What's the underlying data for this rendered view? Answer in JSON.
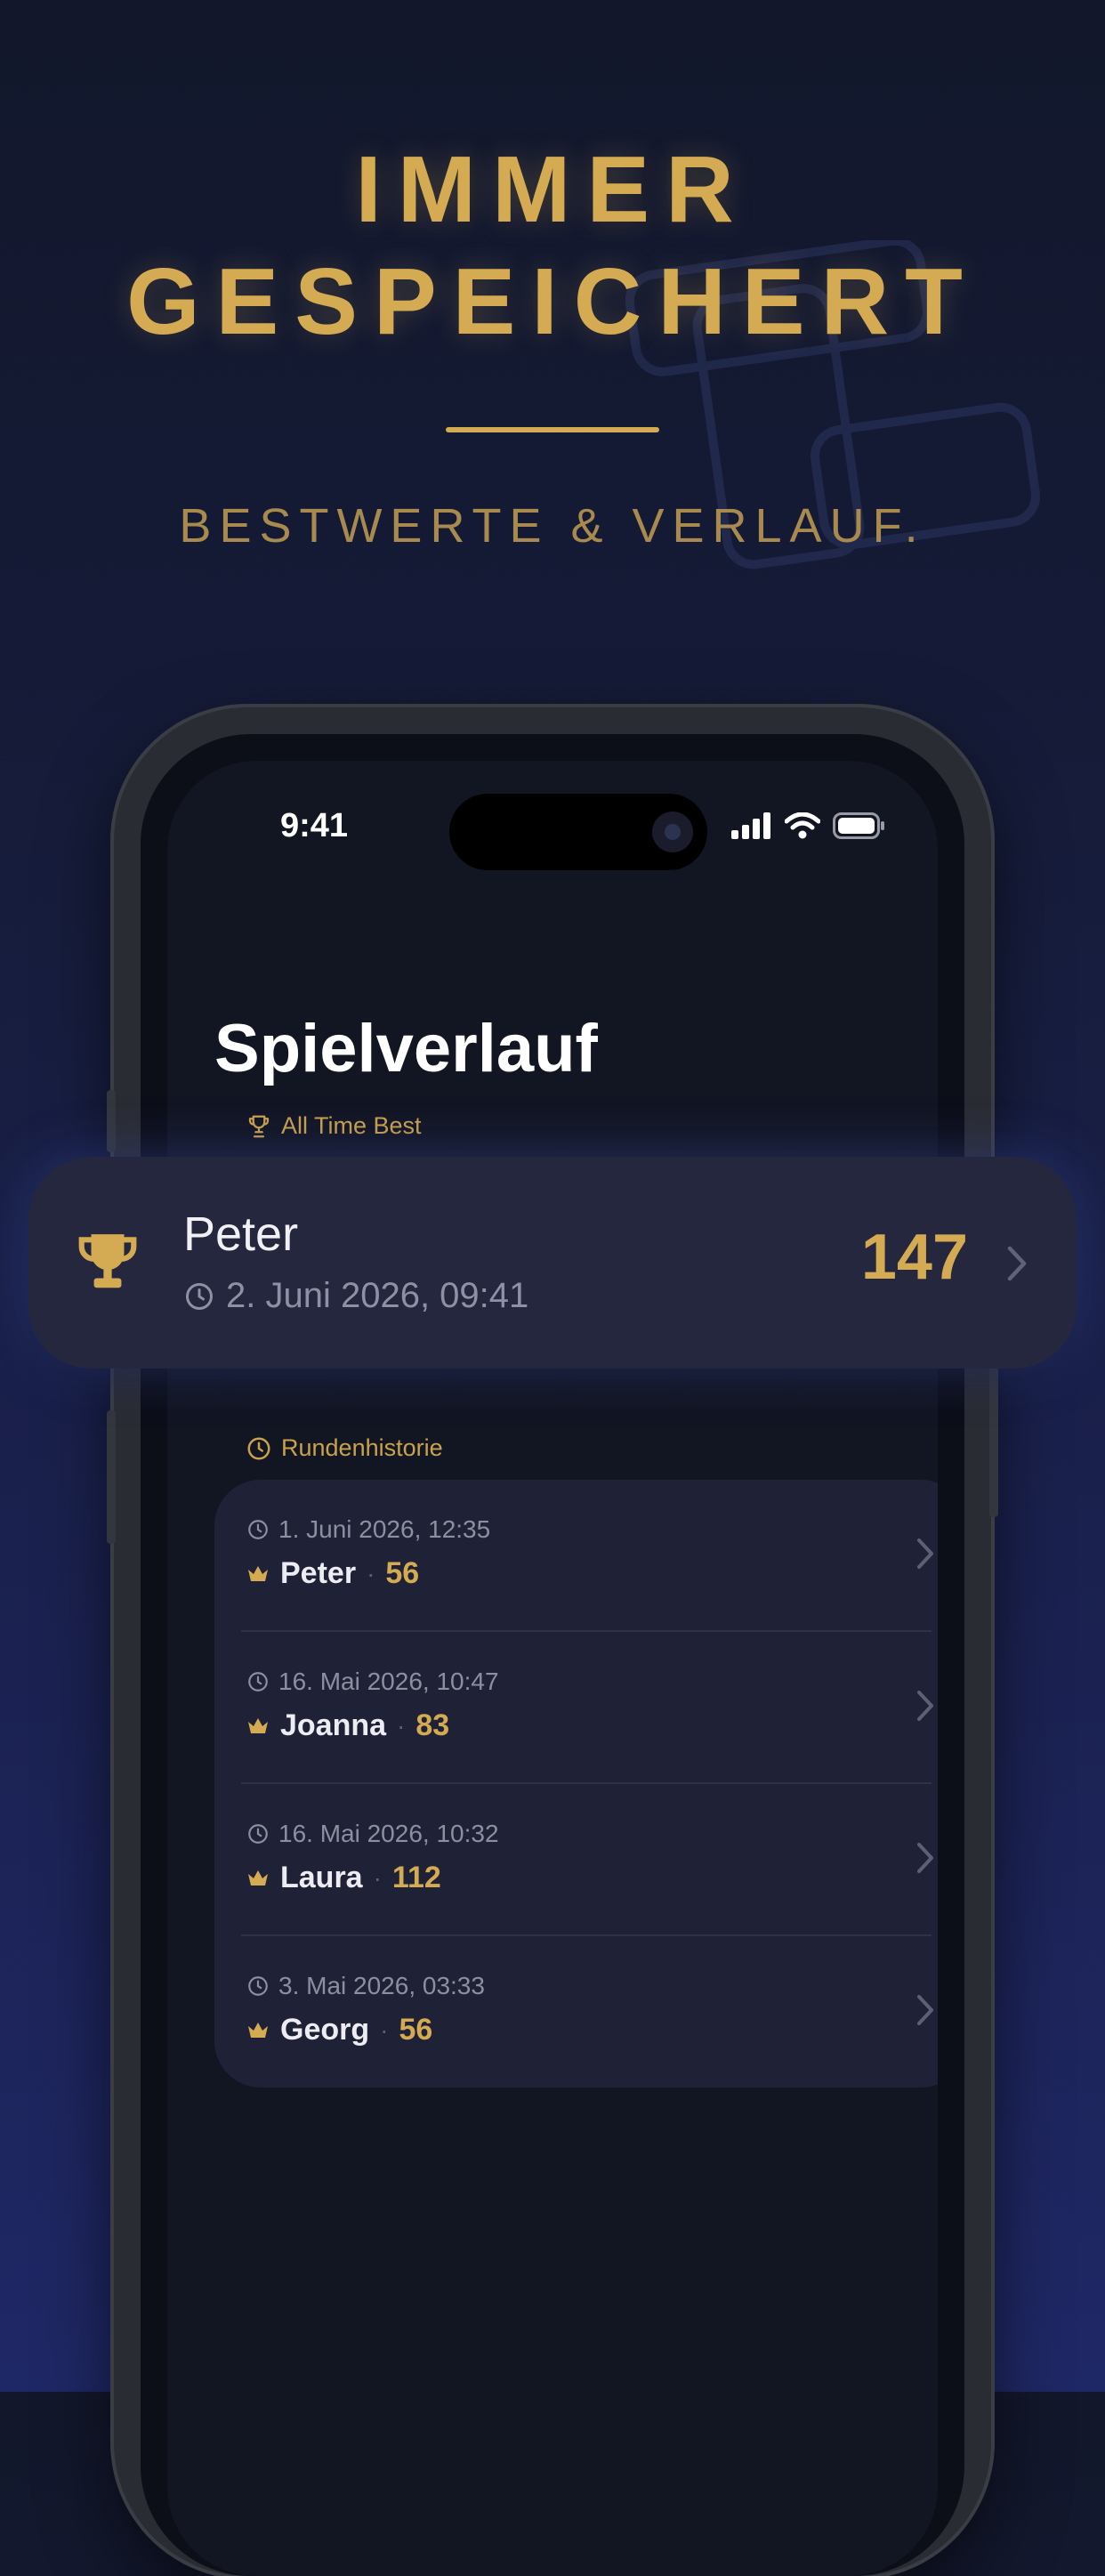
{
  "promo": {
    "headline_line1": "IMMER",
    "headline_line2": "GESPEICHERT",
    "subline": "BESTWERTE & VERLAUF."
  },
  "status_bar": {
    "time": "9:41"
  },
  "screen": {
    "title": "Spielverlauf",
    "best_section_label": "All Time Best",
    "history_section_label": "Rundenhistorie"
  },
  "best": {
    "name": "Peter",
    "date": "2. Juni 2026, 09:41",
    "score": "147"
  },
  "history": [
    {
      "date": "1. Juni 2026, 12:35",
      "name": "Peter",
      "separator": "·",
      "score": "56"
    },
    {
      "date": "16. Mai 2026, 10:47",
      "name": "Joanna",
      "separator": "·",
      "score": "83"
    },
    {
      "date": "16. Mai 2026, 10:32",
      "name": "Laura",
      "separator": "·",
      "score": "112"
    },
    {
      "date": "3. Mai 2026, 03:33",
      "name": "Georg",
      "separator": "·",
      "score": "56"
    }
  ],
  "colors": {
    "gold": "#d4aa52",
    "background": "#161c3a",
    "card": "#1f2236"
  },
  "icons": [
    "trophy-icon",
    "clock-icon",
    "crown-icon",
    "chevron-right-icon",
    "signal-icon",
    "wifi-icon",
    "battery-icon"
  ]
}
